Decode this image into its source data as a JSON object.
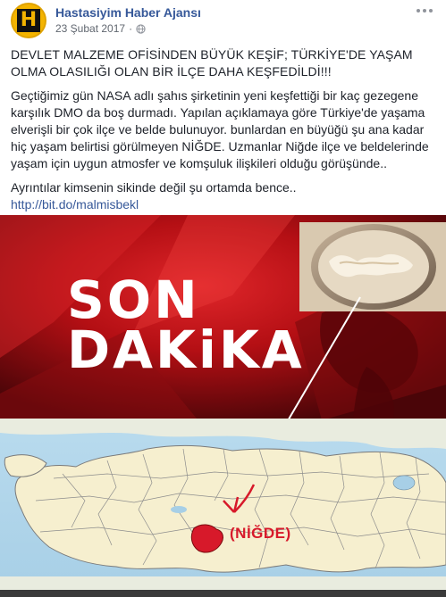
{
  "post": {
    "page_name": "Hastasiyim Haber Ajansı",
    "date": "23 Şubat 2017",
    "separator": "·",
    "avatar_letter": "H",
    "headline": "DEVLET MALZEME OFİSİNDEN BÜYÜK KEŞİF; TÜRKİYE'DE YAŞAM OLMA OLASILIĞI OLAN BİR İLÇE DAHA KEŞFEDİLDİ!!!",
    "body": "Geçtiğimiz gün NASA adlı şahıs şirketinin yeni keşfettiği bir kaç gezegene karşılık DMO da boş durmadı. Yapılan açıklamaya göre Türkiye'de yaşama elverişli bir çok ilçe ve belde bulunuyor. bunlardan en büyüğü şu ana kadar hiç yaşam belirtisi görülmeyen NİĞDE. Uzmanlar Niğde ilçe ve beldelerinde yaşam için uygun atmosfer ve komşuluk ilişkileri olduğu görüşünde..",
    "details": "Ayrıntılar kimsenin sikinde değil şu ortamda bence..",
    "link": "http://bit.do/malmisbekl"
  },
  "image": {
    "son": "SON",
    "dakika": "DAKiKA",
    "map_label": "(NİĞDE)"
  },
  "colors": {
    "link": "#365899",
    "accent_red": "#d7192a",
    "avatar_yellow": "#f4b400"
  },
  "icons": [
    "globe-icon",
    "more-icon"
  ]
}
